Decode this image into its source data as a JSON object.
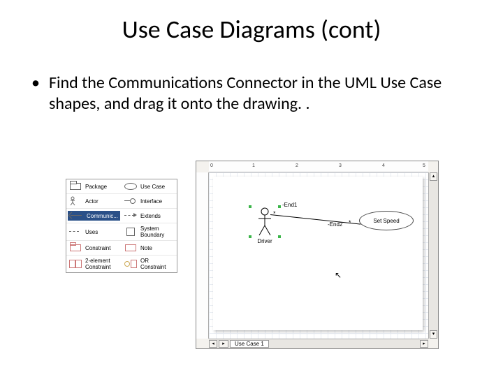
{
  "title": "Use Case Diagrams (cont)",
  "bullet_text": "Find the Communications Connector in the UML Use Case shapes, and drag it onto the drawing. .",
  "palette": {
    "rows": [
      [
        "Package",
        "Use Case"
      ],
      [
        "Actor",
        "Interface"
      ],
      [
        "Communic...",
        "Extends"
      ],
      [
        "Uses",
        "System Boundary"
      ],
      [
        "Constraint",
        "Note"
      ],
      [
        "2-element Constraint",
        "OR Constraint"
      ]
    ],
    "selected": "Communic..."
  },
  "diagram": {
    "actor_label": "Driver",
    "usecase_label": "Set Speed",
    "end1": "-End1",
    "end2": "-End2",
    "star": "*",
    "tab_label": "Use Case 1"
  },
  "ruler_marks": [
    "0",
    "1",
    "2",
    "3",
    "4",
    "5"
  ]
}
